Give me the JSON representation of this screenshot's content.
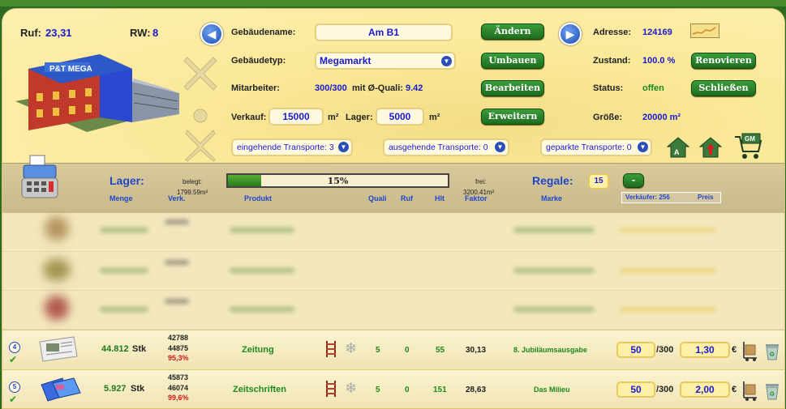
{
  "header": {
    "ruf_label": "Ruf:",
    "ruf_value": "23,31",
    "rw_label": "RW:",
    "rw_value": "8",
    "building_name_label": "Gebäudename:",
    "building_name_value": "Am B1",
    "building_type_label": "Gebäudetyp:",
    "building_type_value": "Megamarkt",
    "employees_label": "Mitarbeiter:",
    "employees_value": "300/300",
    "quali_label": "mit Ø-Quali:",
    "quali_value": "9.42",
    "verkauf_label": "Verkauf:",
    "verkauf_value": "15000",
    "verkauf_unit": "m²",
    "lager_label": "Lager:",
    "lager_value": "5000",
    "lager_unit": "m²",
    "btn_aendern": "Ändern",
    "btn_umbauen": "Umbauen",
    "btn_bearbeiten": "Bearbeiten",
    "btn_erweitern": "Erweitern",
    "address_label": "Adresse:",
    "address_value": "124169",
    "state_label": "Zustand:",
    "state_value": "100.0 %",
    "status_label": "Status:",
    "status_value": "offen",
    "size_label": "Größe:",
    "size_value": "20000 m²",
    "btn_renovieren": "Renovieren",
    "btn_schliessen": "Schließen",
    "transport_in": "eingehende Transporte: 3",
    "transport_out": "ausgehende Transporte: 0",
    "transport_parked": "geparkte Transporte: 0",
    "icon_gm_label": "GM"
  },
  "storage": {
    "lager_title": "Lager:",
    "belegt_label": "belegt:",
    "belegt_value": "1799.59m²",
    "progress_percent": 15,
    "progress_text": "15%",
    "frei_label": "frei:",
    "frei_value": "3200.41m²",
    "regale_label": "Regale:",
    "regale_value": "15",
    "minus_label": "-",
    "verkaeufer_label": "Verkäufer: 256",
    "preis_label": "Preis"
  },
  "columns": {
    "menge": "Menge",
    "verk": "Verk.",
    "produkt": "Produkt",
    "quali": "Quali",
    "ruf": "Ruf",
    "hlt": "Hlt",
    "faktor": "Faktor",
    "marke": "Marke"
  },
  "rows": [
    {
      "badge": "4",
      "menge": "44.812",
      "unit": "Stk",
      "verk1": "42788",
      "verk2": "44875",
      "verk_pct": "95,3%",
      "produkt": "Zeitung",
      "quali": "5",
      "ruf": "0",
      "hlt": "55",
      "faktor": "30,13",
      "marke": "8. Jubiläumsausgabe",
      "verkaeufer": "50",
      "max": "/300",
      "preis": "1,30",
      "currency": "€"
    },
    {
      "badge": "5",
      "menge": "5.927",
      "unit": "Stk",
      "verk1": "45873",
      "verk2": "46074",
      "verk_pct": "99,6%",
      "produkt": "Zeitschriften",
      "quali": "5",
      "ruf": "0",
      "hlt": "151",
      "faktor": "28,63",
      "marke": "Das Milieu",
      "verkaeufer": "50",
      "max": "/300",
      "preis": "2,00",
      "currency": "€"
    }
  ],
  "colors": {
    "accent_blue": "#1a1ad0",
    "button_green": "#1e6b1e",
    "panel_bg": "#fbe99a",
    "bar_bg": "#d8c99b"
  },
  "icons": [
    "nav-left-icon",
    "nav-right-icon",
    "chart-icon",
    "cash-register-icon",
    "building-icon",
    "shelf-icon",
    "snowflake-icon",
    "trolley-icon",
    "trash-icon",
    "check-icon",
    "dropdown-icon"
  ]
}
